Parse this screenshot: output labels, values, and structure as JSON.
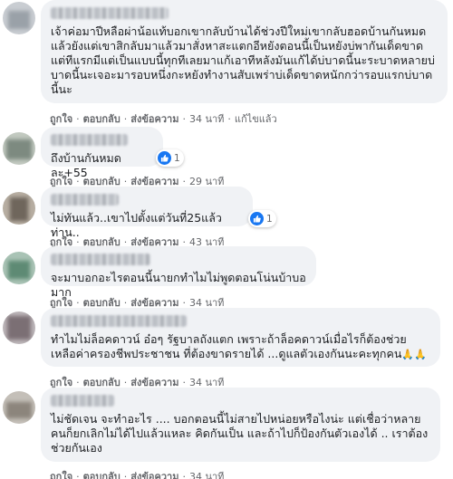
{
  "comments": [
    {
      "text": "เจ้าค่อมาปีหลือผ่าน้อแท้บอกเขากลับบ้านได้ช่วงปีใหม่เขากลับฮอดบ้านกันหมดแล้วยังแต่เขาสิกลับมาแล้วมาสั่งหาสะแตกอีหยังตอนนี้เป็นหยังบ่พากันเด็ดขาดแต่ทีแรกมีแต่เป็นแบบนี้ทุกทีเลยมาแก้เอาทีหลังมันแก้ได้บ่บาดนี้นะระบาดหลายบ่บาดนี้นะเจอะมารอบหนึ่งกะหยังทำงานสับเพร่าบ่เด็ดขาดหนักกว่ารอบแรกบ่บาดนี้นะ",
      "actions": [
        "ถูกใจ",
        "ตอบกลับ",
        "ส่งข้อความ"
      ],
      "time": "34 นาที",
      "edited": "แก้ไขแล้ว"
    },
    {
      "text": "ถึงบ้านกันหมดละ+55",
      "actions": [
        "ถูกใจ",
        "ตอบกลับ",
        "ส่งข้อความ"
      ],
      "time": "29 นาที",
      "reaction_count": "1"
    },
    {
      "text": "ไม่ทันแล้ว..เขาไปตั้งแต่วันที่25แล้วท่าน..",
      "actions": [
        "ถูกใจ",
        "ตอบกลับ",
        "ส่งข้อความ"
      ],
      "time": "43 นาที",
      "reaction_count": "1"
    },
    {
      "text": "จะมาบอกอะไรตอนนี้นายกทำไมไม่พูดตอนโน่นบ้าบอมาก",
      "actions": [
        "ถูกใจ",
        "ตอบกลับ",
        "ส่งข้อความ"
      ],
      "time": "34 นาที"
    },
    {
      "text": "ทำไมไม่ล็อคดาวน์ อ๋อๆ รัฐบาลถังแตก เพราะถ้าล็อคดาวน์เมื่อไรก็ต้องช่วยเหลือค่าครองชีพประชาชน ที่ต้องขาดรายได้ ...ดูแลตัวเองกันนะคะทุกคน",
      "emoji": "🙏🙏",
      "actions": [
        "ถูกใจ",
        "ตอบกลับ",
        "ส่งข้อความ"
      ],
      "time": "34 นาที"
    },
    {
      "text": "ไม่ชัดเจน จะทำอะไร .... บอกตอนนี้ไม่สายไปหน่อยหรือไงน่ะ แต่เชื่อว่าหลายคนก็ยกเลิกไม่ได้ไปแล้วแหละ คิดกันเป็น และถ้าไปก็ป้องกันตัวเองได้ .. เราต้องช่วยกันเอง",
      "actions": [
        "ถูกใจ",
        "ตอบกลับ",
        "ส่งข้อความ"
      ],
      "time": "34 นาที"
    }
  ],
  "colors": {
    "bubble": "#f0f2f5",
    "meta": "#65676b",
    "like": "#1877f2"
  },
  "icons": {
    "reaction": "like-thumb-icon"
  }
}
